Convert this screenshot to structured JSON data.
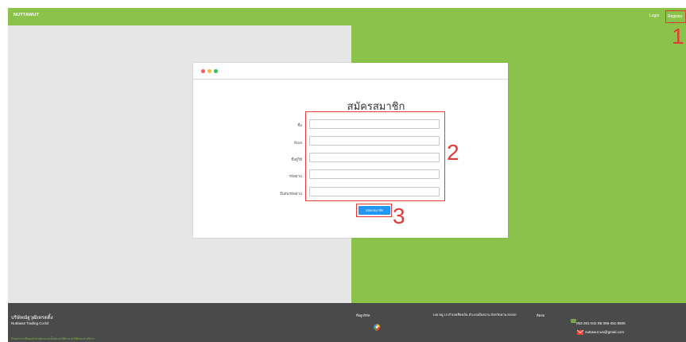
{
  "navbar": {
    "brand": "NUTTAWUT",
    "login": "Login",
    "register": "Register"
  },
  "annotations": {
    "n1": "1",
    "n2": "2",
    "n3": "3"
  },
  "form": {
    "title": "สมัครสมาชิก",
    "fields": [
      {
        "label": "ชื่อ",
        "value": ""
      },
      {
        "label": "อีเมล",
        "value": ""
      },
      {
        "label": "ชื่อผู้ใช้",
        "value": ""
      },
      {
        "label": "รหัสผ่าน",
        "value": ""
      },
      {
        "label": "ยืนยันรหัสผ่าน",
        "value": ""
      }
    ],
    "submit": "สมัครสมาชิก"
  },
  "footer": {
    "company_th": "บริษัทณัฐวุฒิเทรดดิ้ง",
    "company_en": "Nuttawut Trading Co.ltd",
    "links": "ร้านอาหาร ดีลเลอร์ ค่าส่งงาน ค่าน้ำมัน ค่าใช้จ่าย ค่าใช้จ่าย ค่าบริการ",
    "map_title": "ที่อยู่บริษัท",
    "address": "146 หมู่ 10 ตำบลเชียงเงิน อำเภอเมืองน่าน จังหวัดน่าน 50100",
    "contact_title": "ติดต่อ",
    "phone": "053-381-042 ต่อ 086-451-8505",
    "email": "nuttawut.wo@gmail.com"
  },
  "colors": {
    "brand_green": "#8bc34a",
    "annotation_red": "#e53935",
    "button_blue": "#2196f3",
    "footer_gray": "#4a4a4a"
  }
}
